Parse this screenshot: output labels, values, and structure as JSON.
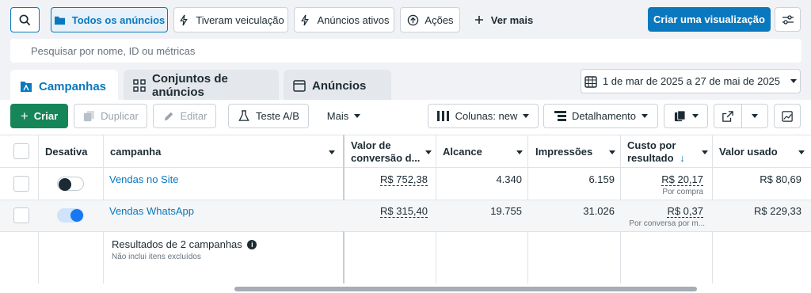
{
  "filters": {
    "todos": "Todos os anúncios",
    "tiveram": "Tiveram veiculação",
    "ativos": "Anúncios ativos",
    "acoes": "Ações",
    "ver_mais": "Ver mais",
    "criar_visualizacao": "Criar uma visualização"
  },
  "search": {
    "placeholder": "Pesquisar por nome, ID ou métricas"
  },
  "tabs": [
    {
      "label": "Campanhas"
    },
    {
      "label": "Conjuntos de anúncios"
    },
    {
      "label": "Anúncios"
    }
  ],
  "date_range": "1 de mar de 2025 a 27 de mai de 2025",
  "toolbar": {
    "criar": "Criar",
    "duplicar": "Duplicar",
    "editar": "Editar",
    "teste": "Teste A/B",
    "mais": "Mais",
    "colunas": "Colunas: new",
    "detalhamento": "Detalhamento"
  },
  "table": {
    "headers": {
      "desativa": "Desativa",
      "campanha": "campanha",
      "valor_conv_1": "Valor de",
      "valor_conv_2": "conversão d...",
      "alcance": "Alcance",
      "impressoes": "Impressões",
      "custo_1": "Custo por",
      "custo_2": "resultado",
      "valor_usado": "Valor usado"
    },
    "rows": [
      {
        "name": "Vendas no Site",
        "toggle_on": false,
        "valor_conv": "R$ 752,38",
        "alcance": "4.340",
        "impressoes": "6.159",
        "custo": "R$ 20,17",
        "custo_sub": "Por compra",
        "valor_usado": "R$ 80,69"
      },
      {
        "name": "Vendas WhatsApp",
        "toggle_on": true,
        "valor_conv": "R$ 315,40",
        "alcance": "19.755",
        "impressoes": "31.026",
        "custo": "R$ 0,37",
        "custo_sub": "Por conversa por m...",
        "valor_usado": "R$ 229,33"
      }
    ],
    "summary": {
      "title": "Resultados de 2 campanhas",
      "subtitle": "Não inclui itens excluídos"
    }
  },
  "colors": {
    "accent": "#0a78be",
    "create": "#168658",
    "toggle_on": "#1877f2",
    "toggle_off": "#1c2b33"
  },
  "scrollbar": {
    "position": 0.36
  }
}
